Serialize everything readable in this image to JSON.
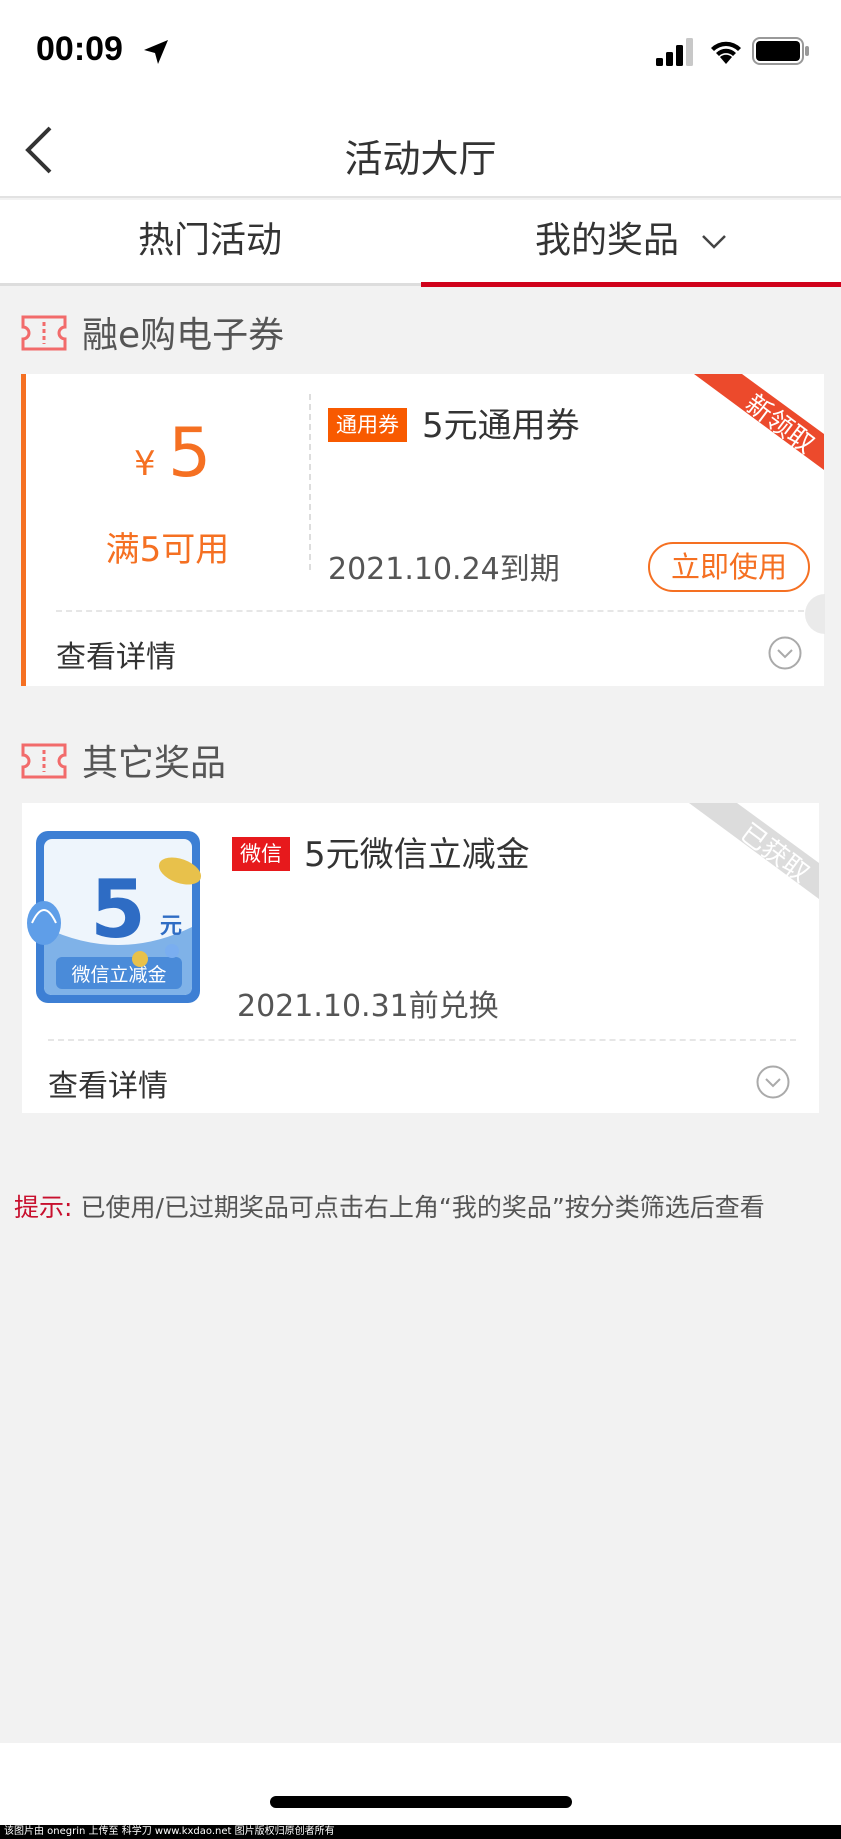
{
  "status_bar": {
    "time": "00:09"
  },
  "nav": {
    "title": "活动大厅"
  },
  "tabs": [
    {
      "label": "热门活动",
      "active": false
    },
    {
      "label": "我的奖品",
      "active": true
    }
  ],
  "sections": {
    "coupon": {
      "title": "融e购电子券"
    },
    "other": {
      "title": "其它奖品"
    }
  },
  "coupon_card": {
    "currency": "¥",
    "amount": "5",
    "condition": "满5可用",
    "tag": "通用券",
    "title": "5元通用券",
    "expiry": "2021.10.24到期",
    "use_button": "立即使用",
    "ribbon": "新领取",
    "details_label": "查看详情"
  },
  "wechat_card": {
    "image": {
      "amount": "5",
      "unit": "元",
      "caption": "微信立减金"
    },
    "tag": "微信",
    "title": "5元微信立减金",
    "redeem_by": "2021.10.31前兑换",
    "ribbon": "已获取",
    "details_label": "查看详情"
  },
  "tip": {
    "label": "提示:",
    "text": "已使用/已过期奖品可点击右上角“我的奖品”按分类筛选后查看"
  },
  "watermark": "该图片由 onegrin 上传至 科学刀 www.kxdao.net 图片版权归原创者所有",
  "colors": {
    "accent_orange": "#f57022",
    "tab_active_underline": "#d0021b",
    "tip_red": "#c8102e",
    "wechat_tag": "#e7191c"
  }
}
